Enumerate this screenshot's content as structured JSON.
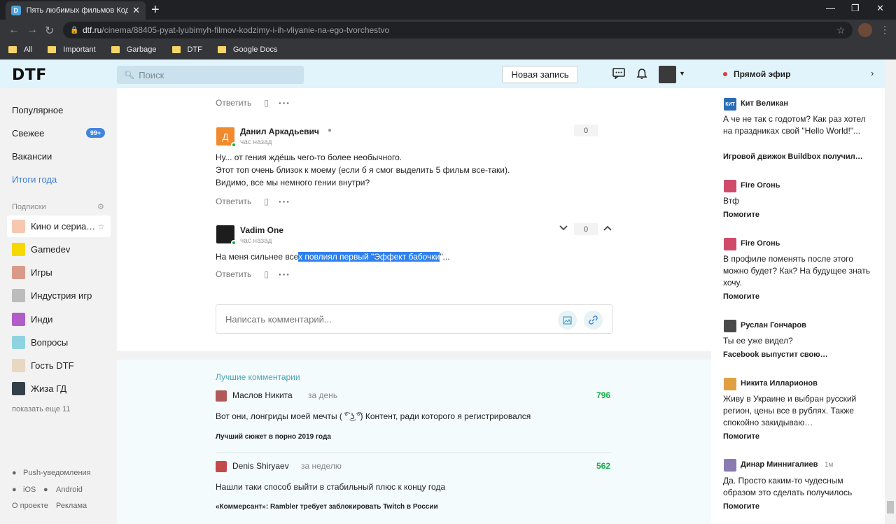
{
  "browser": {
    "tab_title": "Пять любимых фильмов Кодзимы",
    "tab_favicon": "D",
    "url_domain": "dtf.ru",
    "url_path": "/cinema/88405-pyat-lyubimyh-filmov-kodzimy-i-ih-vliyanie-na-ego-tvorchestvo",
    "bookmarks": [
      "All",
      "Important",
      "Garbage",
      "DTF",
      "Google Docs"
    ]
  },
  "header": {
    "logo": "DTF",
    "search_placeholder": "Поиск",
    "new_post": "Новая запись"
  },
  "sidebar": {
    "nav": [
      "Популярное",
      "Свежее",
      "Вакансии",
      "Итоги года"
    ],
    "fresh_badge": "99+",
    "subs_label": "Подписки",
    "subs": [
      "Кино и сериа…",
      "Gamedev",
      "Игры",
      "Индустрия игр",
      "Инди",
      "Вопросы",
      "Гость DTF",
      "Жиза ГД"
    ],
    "show_more": "показать еще 11",
    "push": "Push-уведомления",
    "ios": "iOS",
    "android": "Android",
    "about": "О проекте",
    "ads": "Реклама"
  },
  "comments": {
    "reply_label": "Ответить",
    "items": [
      {
        "avatar_letter": "Д",
        "name": "Данил Аркадьевич",
        "time": "час назад",
        "votes": "0",
        "lines": [
          "Ну... от гения ждёшь чего-то более необычного.",
          "Этот топ очень близок к моему (если б я смог выделить 5 фильм все-таки).",
          "Видимо, все мы немного гении внутри?"
        ]
      },
      {
        "name": "Vadim One",
        "time": "час назад",
        "votes": "0",
        "text_before": "На меня сильнее все",
        "text_selected": "х повлиял первый \"Эффект бабочки",
        "text_after": "\"..."
      }
    ],
    "composer_placeholder": "Написать комментарий..."
  },
  "best": {
    "title": "Лучшие комментарии",
    "items": [
      {
        "name": "Маслов Никита",
        "when": "за день",
        "score": "796",
        "text": "Вот они, лонгриды моей мечты ( ͡° ͜ʖ ͡°) Контент, ради которого я регистрировался",
        "post": "Лучший сюжет в порно 2019 года"
      },
      {
        "name": "Denis Shiryaev",
        "when": "за неделю",
        "score": "562",
        "text": "Нашли таки способ выйти в стабильный плюс к концу года",
        "post": "«Коммерсант»: Rambler требует заблокировать Twitch в России"
      }
    ]
  },
  "live": {
    "title": "Прямой эфир",
    "items": [
      {
        "name": "Кит Великан",
        "avatar_text": "КИТ",
        "text": "А че не так с годотом? Как раз хотел на праздниках свой \"Hello World!\"...",
        "post": "Игровой движок Buildbox получил…"
      },
      {
        "name": "Fire Огонь",
        "text": "Втф",
        "post": "Помогите"
      },
      {
        "name": "Fire Огонь",
        "text": "В профиле поменять после этого можно будет? Как? На будущее знать хочу.",
        "post": "Помогите"
      },
      {
        "name": "Руслан Гончаров",
        "text": "Ты ее уже видел?",
        "post": "Facebook выпустит свою…"
      },
      {
        "name": "Никита Илларионов",
        "text": "Живу в Украине и выбран русский регион, цены все в рублях. Также спокойно закидываю…",
        "post": "Помогите"
      },
      {
        "name": "Динар Миннигалиев",
        "time": "1м",
        "text": "Да. Просто каким-то чудесным образом это сделать получилось",
        "post": "Помогите"
      }
    ]
  }
}
